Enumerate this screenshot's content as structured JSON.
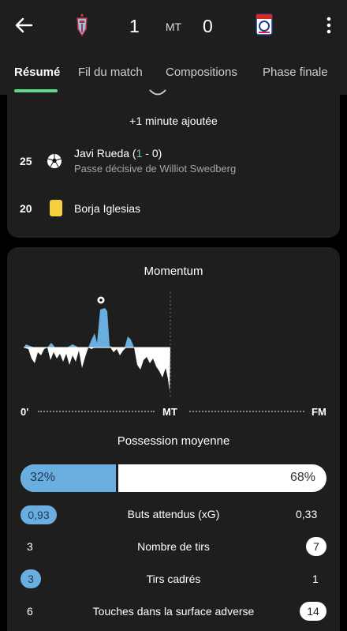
{
  "header": {
    "score_home": "1",
    "score_separator": "MT",
    "score_away": "0",
    "home_crest": "celta-vigo-crest-icon",
    "away_crest": "olympique-lyonnais-crest-icon"
  },
  "tabs": [
    {
      "label": "Résumé",
      "active": true
    },
    {
      "label": "Fil du match",
      "active": false
    },
    {
      "label": "Compositions",
      "active": false
    },
    {
      "label": "Phase finale",
      "active": false
    }
  ],
  "events": {
    "added_time": "+1 minute ajoutée",
    "goal": {
      "minute": "25",
      "player": "Javi Rueda",
      "score_open": " (",
      "score_home": "1",
      "score_rest": " - 0)",
      "assist": "Passe décisive de Williot Swedberg"
    },
    "card": {
      "minute": "20",
      "player": "Borja Iglesias"
    }
  },
  "momentum": {
    "title": "Momentum",
    "start_label": "0'",
    "mid_label": "MT",
    "end_label": "FM"
  },
  "possession": {
    "title": "Possession moyenne",
    "home": "32%",
    "away": "68%",
    "home_fraction": 0.32
  },
  "stats": [
    {
      "home": "0,93",
      "label": "Buts attendus (xG)",
      "away": "0,33",
      "highlight": "home"
    },
    {
      "home": "3",
      "label": "Nombre de tirs",
      "away": "7",
      "highlight": "away"
    },
    {
      "home": "3",
      "label": "Tirs cadrés",
      "away": "1",
      "highlight": "home"
    },
    {
      "home": "6",
      "label": "Touches dans la surface adverse",
      "away": "14",
      "highlight": "away"
    }
  ],
  "colors": {
    "accent_green": "#5fd98c",
    "home_blue": "#6aaee0",
    "card_yellow": "#f4d03f",
    "surface": "#1e1e1e"
  }
}
